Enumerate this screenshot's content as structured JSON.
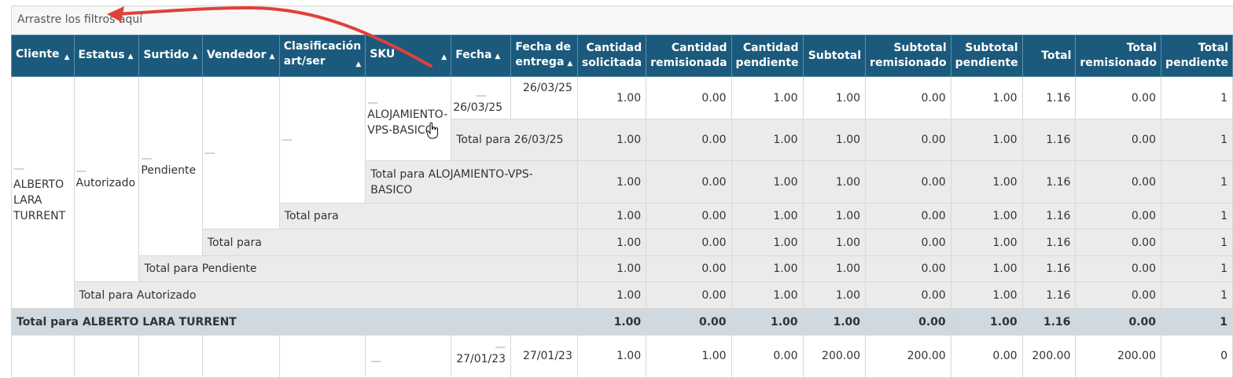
{
  "filter_area": {
    "placeholder": "Arrastre los filtros aquí"
  },
  "columns": [
    "Cliente",
    "Estatus",
    "Surtido",
    "Vendedor",
    "Clasificación art/ser",
    "SKU",
    "Fecha",
    "Fecha de entrega",
    "Cantidad solicitada",
    "Cantidad remisionada",
    "Cantidad pendiente",
    "Subtotal",
    "Subtotal remisionado",
    "Subtotal pendiente",
    "Total",
    "Total remisionado",
    "Total pendiente"
  ],
  "groups": {
    "cliente": "ALBERTO LARA TURRENT",
    "estatus": "Autorizado",
    "surtido": "Pendiente",
    "sku": "ALOJAMIENTO-VPS-BASICO",
    "fecha": "26/03/25"
  },
  "rows": [
    {
      "label": "26/03/25",
      "values": [
        "1.00",
        "0.00",
        "1.00",
        "1.00",
        "0.00",
        "1.00",
        "1.16",
        "0.00",
        "1"
      ]
    },
    {
      "label": "Total para 26/03/25",
      "values": [
        "1.00",
        "0.00",
        "1.00",
        "1.00",
        "0.00",
        "1.00",
        "1.16",
        "0.00",
        "1"
      ]
    },
    {
      "label": "Total para ALOJAMIENTO-VPS-BASICO",
      "values": [
        "1.00",
        "0.00",
        "1.00",
        "1.00",
        "0.00",
        "1.00",
        "1.16",
        "0.00",
        "1"
      ]
    },
    {
      "label": "Total para",
      "values": [
        "1.00",
        "0.00",
        "1.00",
        "1.00",
        "0.00",
        "1.00",
        "1.16",
        "0.00",
        "1"
      ]
    },
    {
      "label": "Total para",
      "values": [
        "1.00",
        "0.00",
        "1.00",
        "1.00",
        "0.00",
        "1.00",
        "1.16",
        "0.00",
        "1"
      ]
    },
    {
      "label": "Total para Pendiente",
      "values": [
        "1.00",
        "0.00",
        "1.00",
        "1.00",
        "0.00",
        "1.00",
        "1.16",
        "0.00",
        "1"
      ]
    },
    {
      "label": "Total para Autorizado",
      "values": [
        "1.00",
        "0.00",
        "1.00",
        "1.00",
        "0.00",
        "1.00",
        "1.16",
        "0.00",
        "1"
      ]
    },
    {
      "label": "Total para ALBERTO LARA TURRENT",
      "values": [
        "1.00",
        "0.00",
        "1.00",
        "1.00",
        "0.00",
        "1.00",
        "1.16",
        "0.00",
        "1"
      ]
    }
  ],
  "next_row": {
    "fecha": "27/01/23",
    "fecha_entrega": "27/01/23",
    "values": [
      "1.00",
      "1.00",
      "0.00",
      "200.00",
      "200.00",
      "0.00",
      "200.00",
      "200.00",
      "0"
    ]
  },
  "colors": {
    "header_bg": "#1b5a7c",
    "subtotal_bg": "#ebebeb",
    "grand_total_bg": "#cfd9df",
    "annotation_arrow": "#e0403a"
  }
}
